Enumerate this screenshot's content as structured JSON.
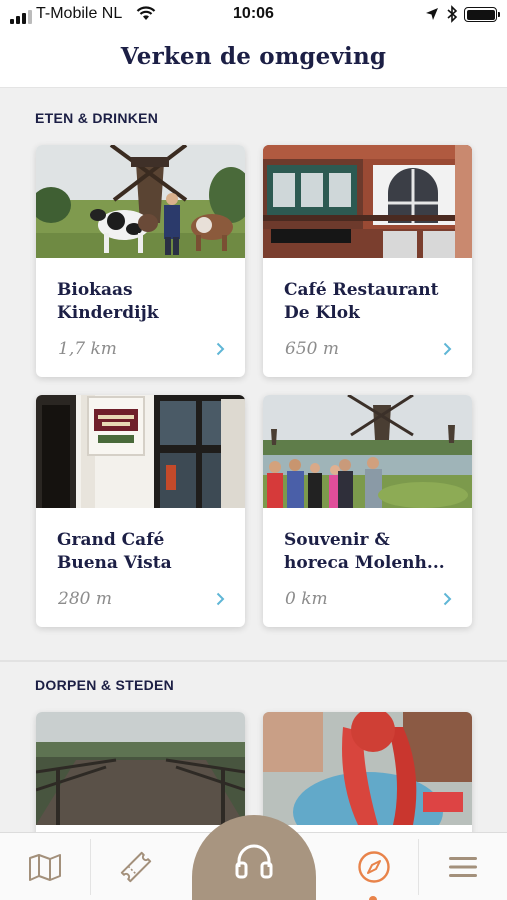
{
  "status_bar": {
    "carrier": "T-Mobile NL",
    "time": "10:06"
  },
  "header": {
    "title": "Verken de omgeving"
  },
  "sections": [
    {
      "title": "ETEN & DRINKEN",
      "cards": [
        {
          "title": "Biokaas\nKinderdijk",
          "distance": "1,7 km",
          "image": "cows-and-windmill-photo"
        },
        {
          "title": "Café Restaurant\nDe Klok",
          "distance": "650 m",
          "image": "brick-cafe-facade-photo"
        },
        {
          "title": "Grand Café\nBuena Vista",
          "distance": "280 m",
          "image": "buena-vista-sign-photo"
        },
        {
          "title": "Souvenir &\nhoreca Molenh...",
          "distance": "0 km",
          "image": "tourists-at-windmills-photo"
        }
      ]
    },
    {
      "title": "DORPEN & STEDEN",
      "cards": [
        {
          "image": "wooden-bridge-photo"
        },
        {
          "image": "red-haired-woman-photo"
        }
      ]
    }
  ],
  "tab_bar": {
    "tabs": [
      {
        "icon": "map-icon"
      },
      {
        "icon": "ticket-icon"
      },
      {
        "icon": "headphones-icon"
      },
      {
        "icon": "compass-icon",
        "active": true
      },
      {
        "icon": "menu-icon"
      }
    ]
  },
  "colors": {
    "navy": "#1c1f45",
    "accent_blue": "#5fb6d6",
    "active_orange": "#e8834a",
    "audio_tan": "#a89580",
    "tab_icon": "#a3907b"
  }
}
